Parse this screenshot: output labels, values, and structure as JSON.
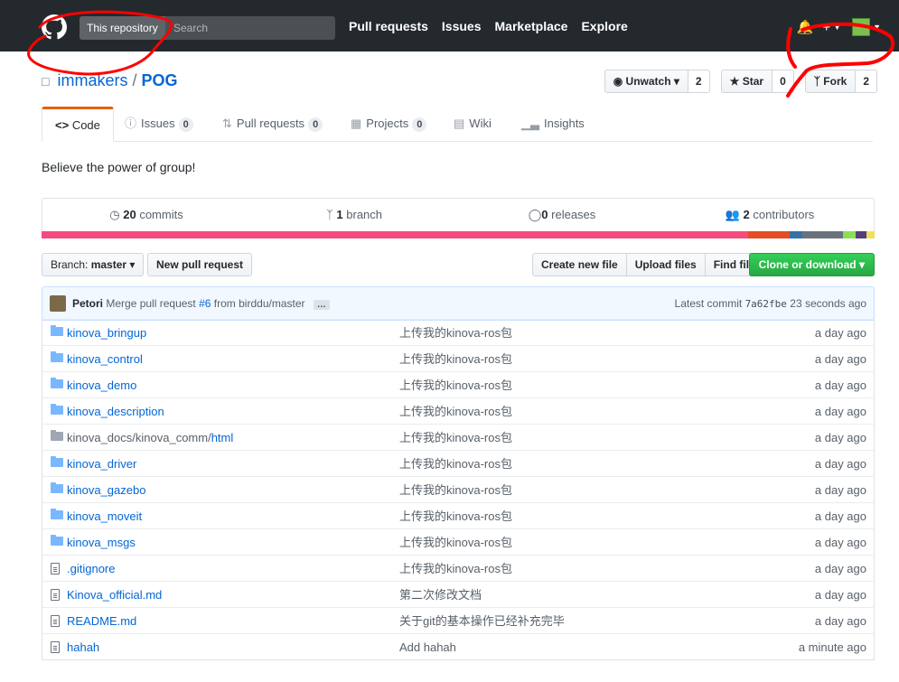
{
  "header": {
    "search_scope": "This repository",
    "search_placeholder": "Search",
    "nav": [
      "Pull requests",
      "Issues",
      "Marketplace",
      "Explore"
    ],
    "plus_icon": "+",
    "bell_icon": "bell-icon"
  },
  "repo": {
    "owner": "immakers",
    "separator": "/",
    "name": "POG",
    "description": "Believe the power of group!"
  },
  "actions": {
    "watch_label": "Unwatch",
    "watch_count": "2",
    "star_label": "Star",
    "star_count": "0",
    "fork_label": "Fork",
    "fork_count": "2"
  },
  "tabs": [
    {
      "label": "Code"
    },
    {
      "label": "Issues",
      "count": "0"
    },
    {
      "label": "Pull requests",
      "count": "0"
    },
    {
      "label": "Projects",
      "count": "0"
    },
    {
      "label": "Wiki"
    },
    {
      "label": "Insights"
    }
  ],
  "summary": {
    "commits_num": "20",
    "commits_label": "commits",
    "branch_num": "1",
    "branch_label": "branch",
    "releases_num": "0",
    "releases_label": "releases",
    "contributors_num": "2",
    "contributors_label": "contributors"
  },
  "language_colors": [
    "#f34b7d",
    "#f34b7d",
    "#e34c26",
    "#3572a5",
    "#6a737d",
    "#89e051",
    "#563d7c",
    "#f1e05a"
  ],
  "filenav": {
    "branch_prefix": "Branch:",
    "branch_name": "master",
    "new_pr": "New pull request",
    "create_file": "Create new file",
    "upload_files": "Upload files",
    "find_file": "Find file",
    "clone": "Clone or download"
  },
  "latest_commit": {
    "author": "Petori",
    "message_prefix": "Merge pull request",
    "pr_link": "#6",
    "message_suffix": "from birddu/master",
    "ellipsis": "…",
    "latest_label": "Latest commit",
    "sha": "7a62fbe",
    "age": "23 seconds ago"
  },
  "files": [
    {
      "type": "dir",
      "name": "kinova_bringup",
      "message": "上传我的kinova-ros包",
      "age": "a day ago"
    },
    {
      "type": "dir",
      "name": "kinova_control",
      "message": "上传我的kinova-ros包",
      "age": "a day ago"
    },
    {
      "type": "dir",
      "name": "kinova_demo",
      "message": "上传我的kinova-ros包",
      "age": "a day ago"
    },
    {
      "type": "dir",
      "name": "kinova_description",
      "message": "上传我的kinova-ros包",
      "age": "a day ago"
    },
    {
      "type": "dir-path",
      "name_prefix": "kinova_docs/kinova_comm/",
      "name": "html",
      "message": "上传我的kinova-ros包",
      "age": "a day ago"
    },
    {
      "type": "dir",
      "name": "kinova_driver",
      "message": "上传我的kinova-ros包",
      "age": "a day ago"
    },
    {
      "type": "dir",
      "name": "kinova_gazebo",
      "message": "上传我的kinova-ros包",
      "age": "a day ago"
    },
    {
      "type": "dir",
      "name": "kinova_moveit",
      "message": "上传我的kinova-ros包",
      "age": "a day ago"
    },
    {
      "type": "dir",
      "name": "kinova_msgs",
      "message": "上传我的kinova-ros包",
      "age": "a day ago"
    },
    {
      "type": "file",
      "name": ".gitignore",
      "message": "上传我的kinova-ros包",
      "age": "a day ago"
    },
    {
      "type": "file",
      "name": "Kinova_official.md",
      "message": "第二次修改文档",
      "age": "a day ago"
    },
    {
      "type": "file",
      "name": "README.md",
      "message": "关于git的基本操作已经补充完毕",
      "age": "a day ago"
    },
    {
      "type": "file",
      "name": "hahah",
      "message": "Add hahah",
      "age": "a minute ago"
    }
  ]
}
